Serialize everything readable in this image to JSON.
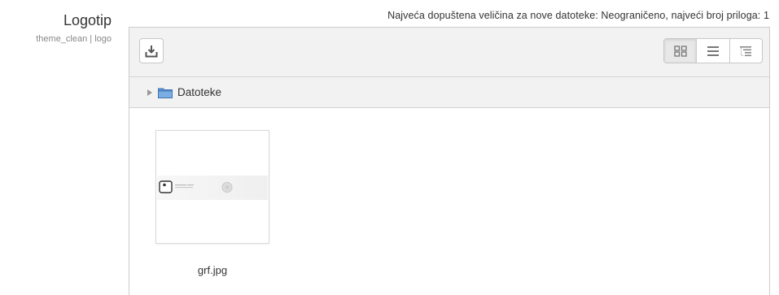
{
  "setting": {
    "title": "Logotip",
    "subtitle": "theme_clean | logo"
  },
  "limits_text": "Najveća dopuštena veličina za nove datoteke: Neograničeno, najveći broj priloga: 1",
  "toolbar": {
    "download_icon": "download-icon",
    "views": [
      {
        "icon": "grid-view-icon",
        "active": true
      },
      {
        "icon": "list-view-icon",
        "active": false
      },
      {
        "icon": "tree-view-icon",
        "active": false
      }
    ]
  },
  "path": {
    "folder_label": "Datoteke"
  },
  "files": [
    {
      "name": "grf.jpg"
    }
  ],
  "colors": {
    "toolbar_bg": "#f2f2f2",
    "border": "#cccccc",
    "folder_blue": "#4a86c5"
  }
}
